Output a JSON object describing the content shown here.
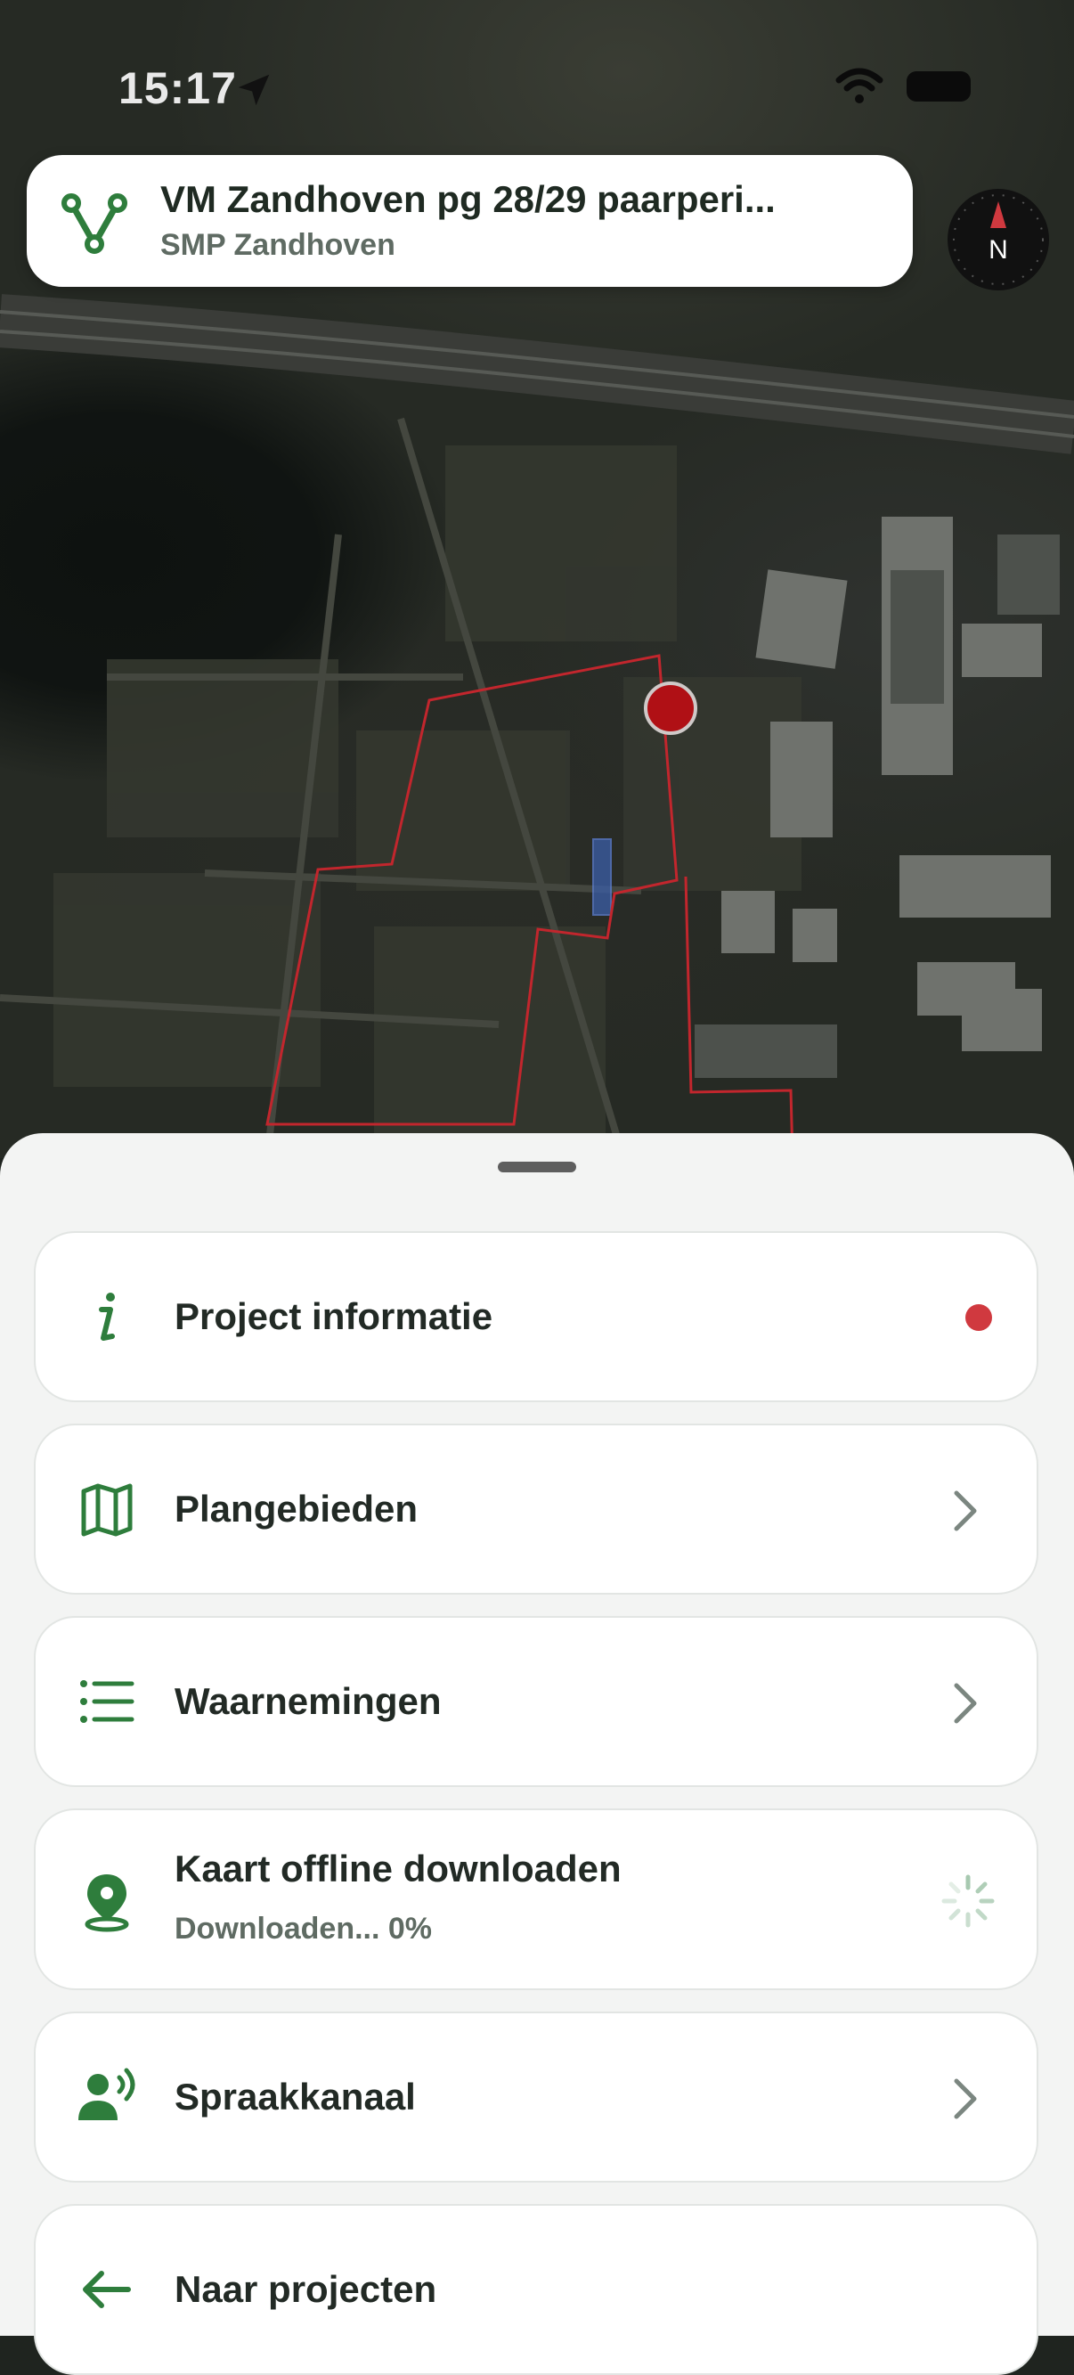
{
  "status_bar": {
    "time": "15:17"
  },
  "header": {
    "title": "VM Zandhoven pg 28/29 paarperi...",
    "subtitle": "SMP Zandhoven",
    "logo_icon": "route-logo-icon",
    "compass_label": "N"
  },
  "menu": {
    "items": [
      {
        "label": "Project informatie",
        "icon": "info-icon",
        "indicator": "red-dot"
      },
      {
        "label": "Plangebieden",
        "icon": "map-icon",
        "indicator": "chevron-right"
      },
      {
        "label": "Waarnemingen",
        "icon": "list-icon",
        "indicator": "chevron-right"
      },
      {
        "label": "Kaart offline downloaden",
        "sublabel": "Downloaden... 0%",
        "progress": 0,
        "icon": "location-pin-icon",
        "indicator": "spinner"
      },
      {
        "label": "Spraakkanaal",
        "icon": "speaking-person-icon",
        "indicator": "chevron-right"
      },
      {
        "label": "Naar projecten",
        "icon": "arrow-left-icon"
      }
    ]
  },
  "colors": {
    "accent": "#2e7d3c",
    "alert": "#d0393f",
    "map_boundary": "#c2262d",
    "map_marker": "#b01015",
    "chevron": "#7b8680"
  }
}
